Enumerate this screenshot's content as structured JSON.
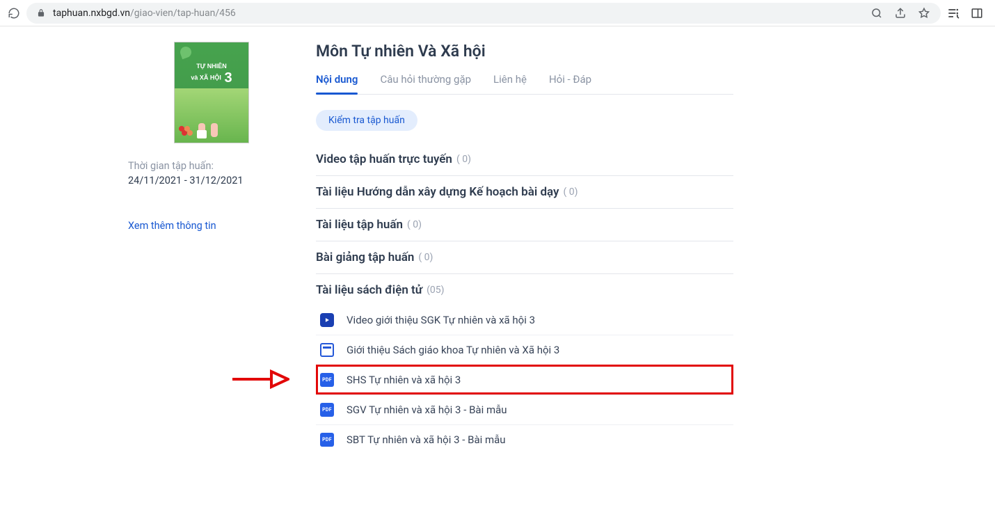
{
  "browser": {
    "url_domain": "taphuan.nxbgd.vn",
    "url_path": "/giao-vien/tap-huan/456"
  },
  "sidebar": {
    "cover_title_line1": "TỰ NHIÊN",
    "cover_title_line2": "và XÃ HỘI",
    "cover_number": "3",
    "time_label": "Thời gian tập huấn:",
    "time_range": "24/11/2021 - 31/12/2021",
    "more_link": "Xem thêm thông tin"
  },
  "main": {
    "title": "Môn Tự nhiên Và Xã hội",
    "tabs": [
      {
        "label": "Nội dung",
        "active": true
      },
      {
        "label": "Câu hỏi thường gặp",
        "active": false
      },
      {
        "label": "Liên hệ",
        "active": false
      },
      {
        "label": "Hỏi - Đáp",
        "active": false
      }
    ],
    "chip": "Kiểm tra tập huấn",
    "sections": [
      {
        "title": "Video tập huấn trực tuyến",
        "count": "( 0)"
      },
      {
        "title": "Tài liệu Hướng dẫn xây dựng Kế hoạch bài dạy",
        "count": "( 0)"
      },
      {
        "title": "Tài liệu tập huấn",
        "count": "( 0)"
      },
      {
        "title": "Bài giảng tập huấn",
        "count": "( 0)"
      },
      {
        "title": "Tài liệu sách điện tử",
        "count": "(05)"
      }
    ],
    "resources": [
      {
        "icon": "play",
        "title": "Video giới thiệu SGK Tự nhiên và xã hội 3"
      },
      {
        "icon": "slide",
        "title": "Giới thiệu Sách giáo khoa Tự nhiên và Xã hội 3"
      },
      {
        "icon": "pdf",
        "title": "SHS Tự nhiên và xã hội 3",
        "highlight": true
      },
      {
        "icon": "pdf",
        "title": "SGV Tự nhiên và xã hội 3 - Bài mẫu"
      },
      {
        "icon": "pdf",
        "title": "SBT Tự nhiên và xã hội 3 - Bài mẫu"
      }
    ]
  }
}
